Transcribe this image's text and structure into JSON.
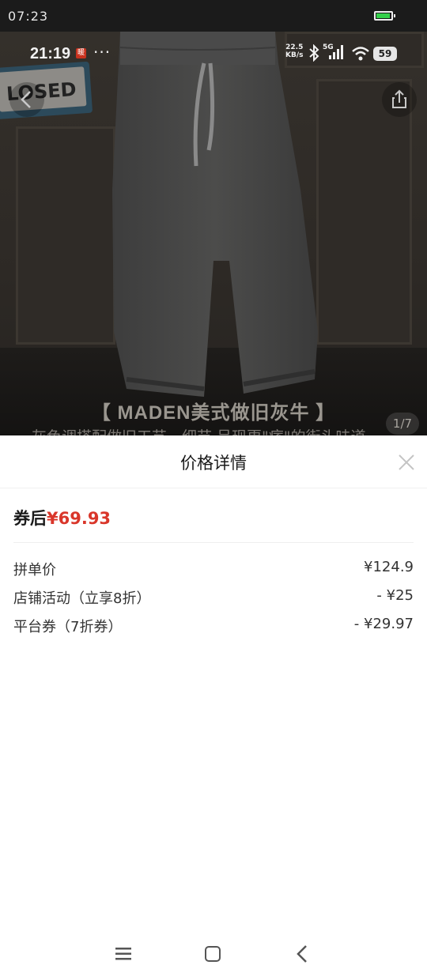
{
  "system_bar": {
    "time": "07:23",
    "battery_level": 0.95,
    "battery_color": "#35d04b"
  },
  "inner_status": {
    "time": "21:19",
    "badge": "暖",
    "dots": "···",
    "speed_top": "22.5",
    "speed_bottom": "KB/s",
    "network": "5G",
    "battery": "59"
  },
  "hero": {
    "sign_text": "LOSED",
    "title": "【 MADEN美式做旧灰牛 】",
    "subtitle": "灰色调搭配做旧工艺，细节 呈现更\"痞\"的街头味道",
    "page_indicator": "1/7"
  },
  "sheet": {
    "title": "价格详情",
    "after_coupon_label": "券后",
    "after_coupon_price": "¥69.93",
    "accent_color": "#d9362a",
    "items": [
      {
        "label": "拼单价",
        "value": "¥124.9"
      },
      {
        "label": "店铺活动（立享8折）",
        "value": "- ¥25"
      },
      {
        "label": "平台券（7折券）",
        "value": "- ¥29.97"
      }
    ]
  }
}
